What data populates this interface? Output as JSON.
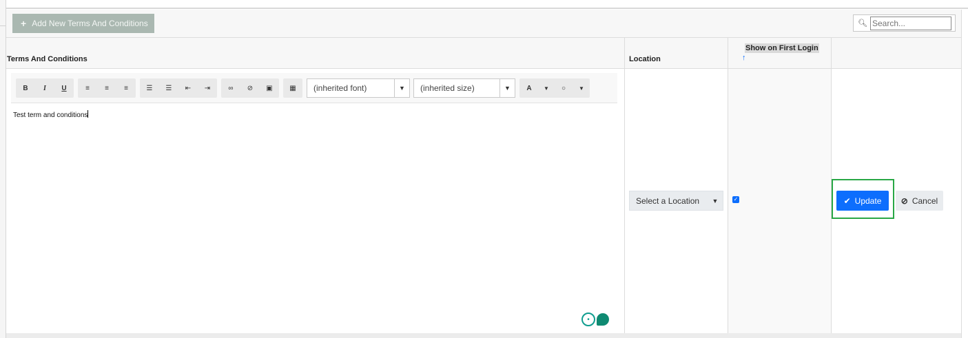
{
  "toolbar": {
    "add_label": "Add New Terms And Conditions",
    "search_placeholder": "Search..."
  },
  "columns": {
    "terms": "Terms And Conditions",
    "location": "Location",
    "show_first_login": "Show on First Login",
    "sort_indicator": "↑"
  },
  "editor": {
    "font_select": "(inherited font)",
    "size_select": "(inherited size)",
    "font_color_label": "A",
    "content": "Test term and conditions"
  },
  "row": {
    "location_select": "Select a Location",
    "show_first_login_checked": true,
    "update_label": "Update",
    "cancel_label": "Cancel"
  },
  "colors": {
    "primary": "#0d6efd",
    "add_button": "#aab8b1",
    "focus_ring": "#28a745"
  }
}
